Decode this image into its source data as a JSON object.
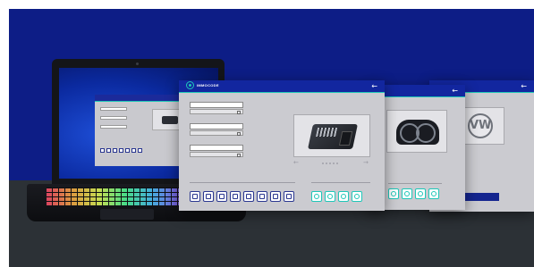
{
  "main_panel": {
    "brand": "IMMOCODE",
    "fields": [
      {
        "label": "",
        "value": "",
        "select": ""
      },
      {
        "label": "",
        "value": "",
        "select": ""
      },
      {
        "label": "",
        "value": "",
        "select": ""
      }
    ],
    "left_section_label": "",
    "right_section_label": ""
  },
  "vw_panel": {
    "logo_letters": "VW",
    "next_button_label": ""
  },
  "cluster_panel": {
    "section_label": ""
  },
  "colors": {
    "header": "#12269f",
    "accent": "#1ec7b8",
    "panel_bg": "#cbcbd0",
    "background_top": "#0d1d86",
    "background_bottom": "#2c3136"
  },
  "icons": {
    "back": "←",
    "prev": "←",
    "next": "→"
  }
}
